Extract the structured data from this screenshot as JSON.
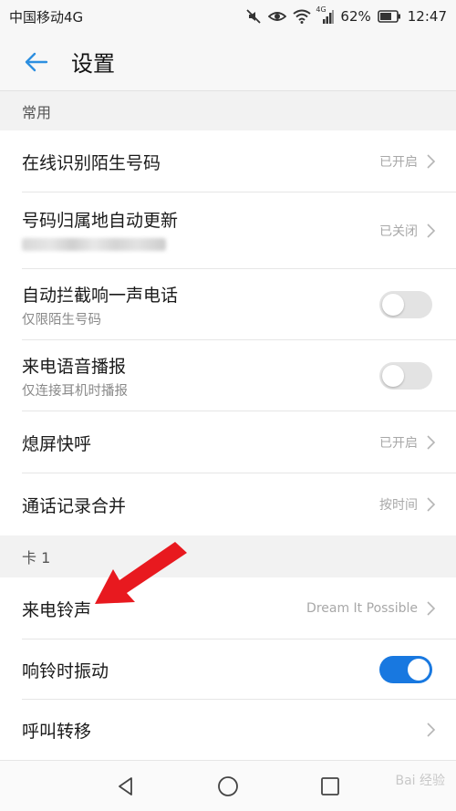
{
  "status_bar": {
    "carrier": "中国移动4G",
    "network_badge": "4G",
    "battery": "62%",
    "time": "12:47",
    "icons": [
      "mute-icon",
      "eye-icon",
      "wifi-icon",
      "signal-icon",
      "battery-icon"
    ]
  },
  "app_bar": {
    "title": "设置",
    "back_icon": "arrow-left-icon"
  },
  "sections": {
    "common": {
      "header": "常用"
    },
    "card1": {
      "header": "卡 1"
    }
  },
  "rows": {
    "online_id": {
      "title": "在线识别陌生号码",
      "value": "已开启"
    },
    "number_location": {
      "title": "号码归属地自动更新",
      "value": "已关闭"
    },
    "block_one_ring": {
      "title": "自动拦截响一声电话",
      "subtitle": "仅限陌生号码",
      "toggle": false
    },
    "caller_announce": {
      "title": "来电语音播报",
      "subtitle": "仅连接耳机时播报",
      "toggle": false
    },
    "screen_off_call": {
      "title": "熄屏快呼",
      "value": "已开启"
    },
    "merge_log": {
      "title": "通话记录合并",
      "value": "按时间"
    },
    "ringtone": {
      "title": "来电铃声",
      "value": "Dream It Possible"
    },
    "vibrate": {
      "title": "响铃时振动",
      "toggle": true
    },
    "call_forward": {
      "title": "呼叫转移"
    }
  },
  "colors": {
    "accent": "#1878e0",
    "back_arrow": "#2d8fe0",
    "annotation_arrow": "#e8191f"
  },
  "watermark": "Bai 经验"
}
